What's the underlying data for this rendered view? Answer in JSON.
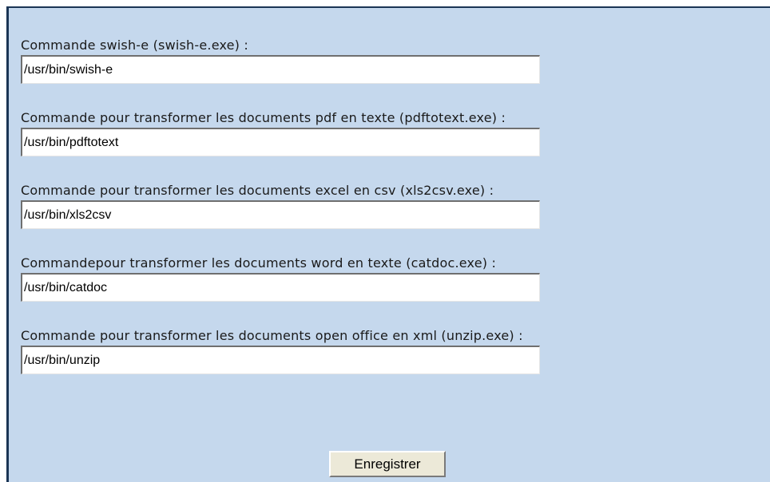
{
  "form": {
    "fields": [
      {
        "label": "Commande swish-e (swish-e.exe) :",
        "value": "/usr/bin/swish-e"
      },
      {
        "label": "Commande pour transformer les documents pdf en texte (pdftotext.exe) :",
        "value": "/usr/bin/pdftotext"
      },
      {
        "label": "Commande pour transformer les documents excel en csv (xls2csv.exe) :",
        "value": "/usr/bin/xls2csv"
      },
      {
        "label": "Commandepour transformer les documents word en texte (catdoc.exe) :",
        "value": "/usr/bin/catdoc"
      },
      {
        "label": "Commande pour transformer les documents open office en xml (unzip.exe) :",
        "value": "/usr/bin/unzip"
      }
    ],
    "submit_label": "Enregistrer"
  },
  "colors": {
    "panel_background": "#c5d8ed",
    "panel_border": "#1b3555",
    "button_face": "#ece9d8"
  }
}
